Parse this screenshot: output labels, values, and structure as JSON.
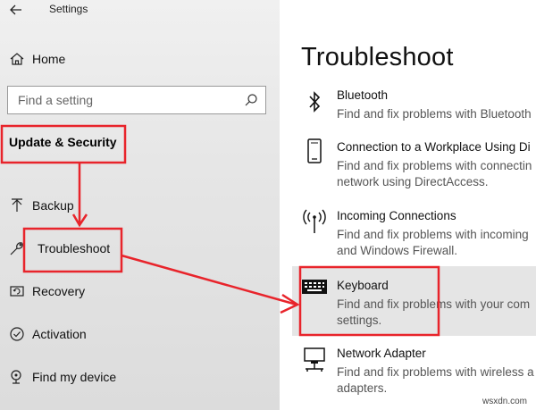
{
  "window": {
    "title": "Settings"
  },
  "sidebar": {
    "home_label": "Home",
    "search_placeholder": "Find a setting",
    "section_title": "Update & Security",
    "items": [
      {
        "label": "Backup",
        "icon": "backup-icon"
      },
      {
        "label": "Troubleshoot",
        "icon": "wrench-icon"
      },
      {
        "label": "Recovery",
        "icon": "recovery-icon"
      },
      {
        "label": "Activation",
        "icon": "activation-check-icon"
      },
      {
        "label": "Find my device",
        "icon": "find-device-icon"
      }
    ]
  },
  "main": {
    "title": "Troubleshoot",
    "items": [
      {
        "name": "Bluetooth",
        "description": "Find and fix problems with Bluetooth",
        "icon": "bluetooth-icon"
      },
      {
        "name": "Connection to a Workplace Using Di",
        "description": "Find and fix problems with connectin\nnetwork using DirectAccess.",
        "icon": "phone-device-icon"
      },
      {
        "name": "Incoming Connections",
        "description": "Find and fix problems with incoming\nand Windows Firewall.",
        "icon": "antenna-icon"
      },
      {
        "name": "Keyboard",
        "description": "Find and fix problems with your com\nsettings.",
        "icon": "keyboard-icon"
      },
      {
        "name": "Network Adapter",
        "description": "Find and fix problems with wireless a\nadapters.",
        "icon": "network-adapter-icon"
      }
    ]
  },
  "watermark": "wsxdn.com",
  "colors": {
    "annotation_red": "#e8242b",
    "selected_bg": "#e5e5e5",
    "sidebar_bg": "#e8e8e8"
  }
}
